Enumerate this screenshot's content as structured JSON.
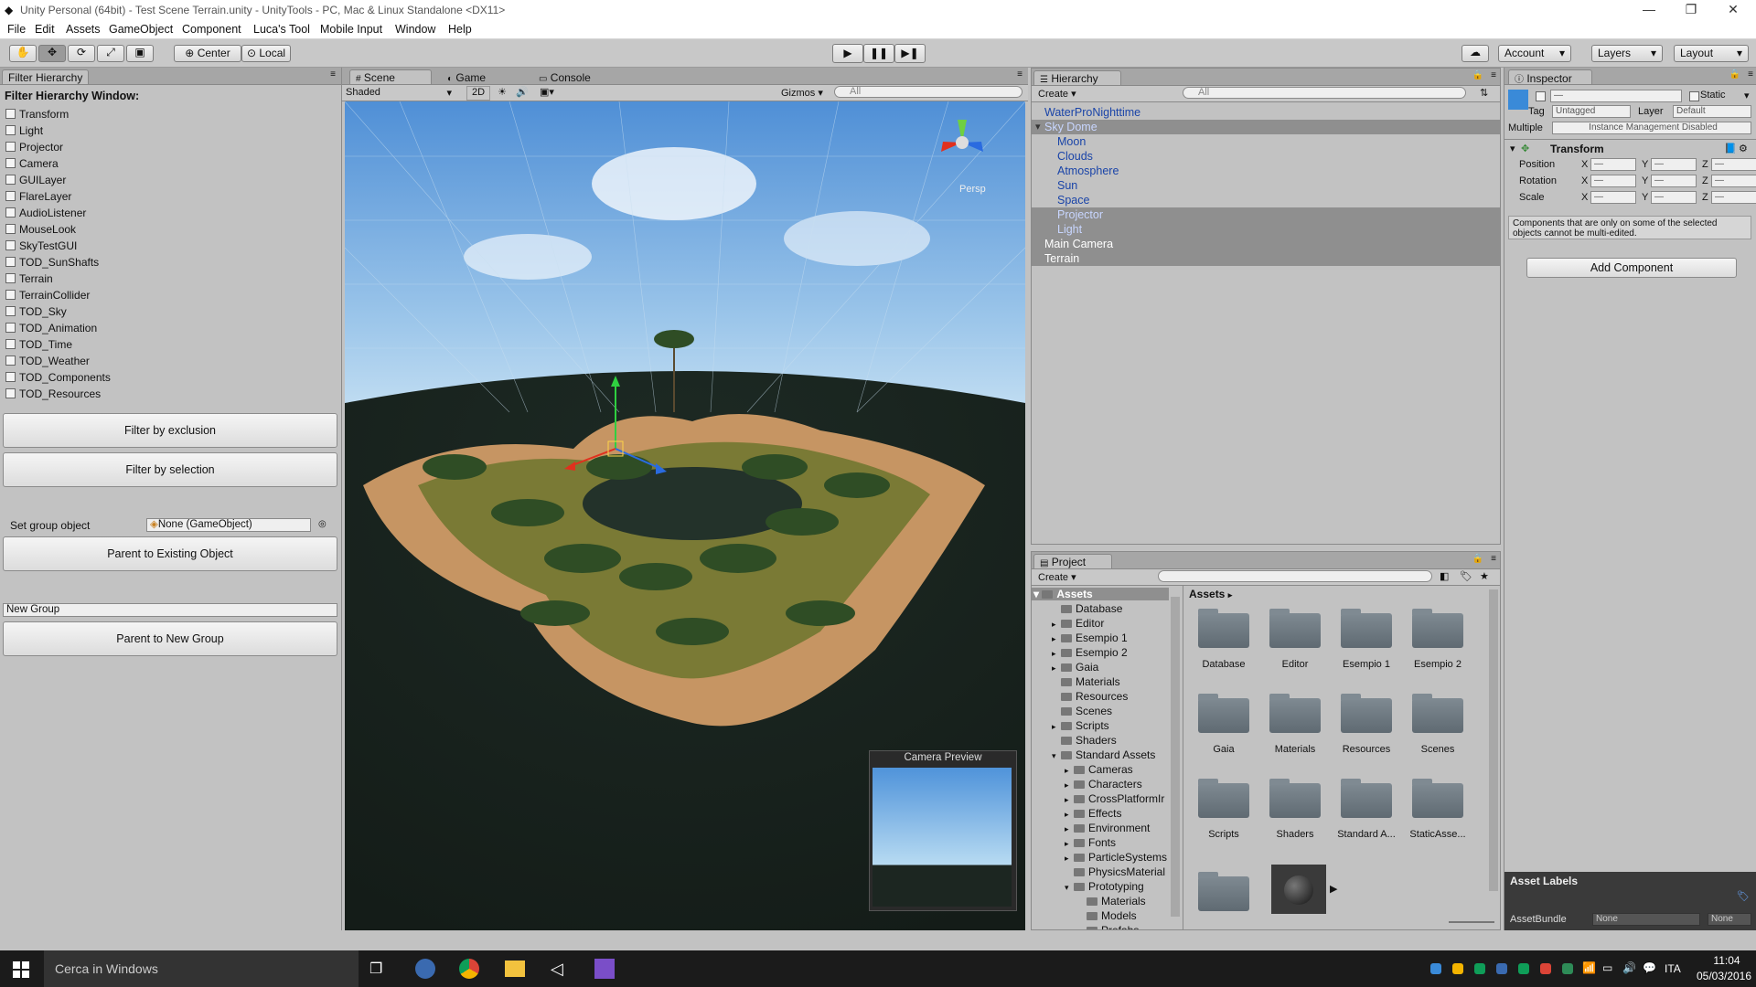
{
  "window": {
    "title": "Unity Personal (64bit) - Test Scene Terrain.unity - UnityTools - PC, Mac & Linux Standalone <DX11>",
    "controls": [
      "—",
      "❐",
      "✕"
    ]
  },
  "menu": [
    "File",
    "Edit",
    "Assets",
    "GameObject",
    "Component",
    "Luca's Tool",
    "Mobile Input",
    "Window",
    "Help"
  ],
  "toolbar": {
    "pivot": "Center",
    "space": "Local",
    "account": "Account",
    "layers": "Layers",
    "layout": "Layout"
  },
  "filter_panel": {
    "tab": "Filter Hierarchy",
    "heading": "Filter Hierarchy Window:",
    "items": [
      "Transform",
      "Light",
      "Projector",
      "Camera",
      "GUILayer",
      "FlareLayer",
      "AudioListener",
      "MouseLook",
      "SkyTestGUI",
      "TOD_SunShafts",
      "Terrain",
      "TerrainCollider",
      "TOD_Sky",
      "TOD_Animation",
      "TOD_Time",
      "TOD_Weather",
      "TOD_Components",
      "TOD_Resources"
    ],
    "btn_exclusion": "Filter by exclusion",
    "btn_selection": "Filter by selection",
    "group_label": "Set group object",
    "group_value": "None (GameObject)",
    "btn_parent_existing": "Parent to Existing Object",
    "new_group_value": "New Group",
    "btn_parent_new": "Parent to New Group"
  },
  "scene": {
    "tabs": [
      "Scene",
      "Game",
      "Console"
    ],
    "shading": "Shaded",
    "mode2d": "2D",
    "gizmos": "Gizmos",
    "search_placeholder": "All",
    "persp": "Persp",
    "camera_preview": "Camera Preview"
  },
  "hierarchy": {
    "tab": "Hierarchy",
    "create": "Create",
    "search_placeholder": "All",
    "items": [
      {
        "name": "WaterProNighttime",
        "indent": 0
      },
      {
        "name": "Sky Dome",
        "indent": 0
      },
      {
        "name": "Moon",
        "indent": 1
      },
      {
        "name": "Clouds",
        "indent": 1
      },
      {
        "name": "Atmosphere",
        "indent": 1
      },
      {
        "name": "Sun",
        "indent": 1
      },
      {
        "name": "Space",
        "indent": 1
      },
      {
        "name": "Projector",
        "indent": 1
      },
      {
        "name": "Light",
        "indent": 1
      },
      {
        "name": "Main Camera",
        "indent": 0
      },
      {
        "name": "Terrain",
        "indent": 0
      }
    ]
  },
  "inspector": {
    "tab": "Inspector",
    "name_value": "—",
    "static_label": "Static",
    "tag_label": "Tag",
    "tag_value": "Untagged",
    "layer_label": "Layer",
    "layer_value": "Default",
    "multiple": "Multiple",
    "instance": "Instance Management Disabled",
    "transform": "Transform",
    "rows": [
      "Position",
      "Rotation",
      "Scale"
    ],
    "axes": [
      "X",
      "Y",
      "Z"
    ],
    "dash": "—",
    "note": "Components that are only on some of the selected objects cannot be multi-edited.",
    "add_component": "Add Component",
    "asset_labels": "Asset Labels",
    "asset_bundle": "AssetBundle",
    "bundle_value": "None",
    "bundle_variant": "None"
  },
  "project": {
    "tab": "Project",
    "create": "Create",
    "root": "Assets",
    "tree": [
      {
        "name": "Database",
        "indent": 1
      },
      {
        "name": "Editor",
        "indent": 1
      },
      {
        "name": "Esempio 1",
        "indent": 1
      },
      {
        "name": "Esempio 2",
        "indent": 1
      },
      {
        "name": "Gaia",
        "indent": 1
      },
      {
        "name": "Materials",
        "indent": 1
      },
      {
        "name": "Resources",
        "indent": 1
      },
      {
        "name": "Scenes",
        "indent": 1
      },
      {
        "name": "Scripts",
        "indent": 1
      },
      {
        "name": "Shaders",
        "indent": 1
      },
      {
        "name": "Standard Assets",
        "indent": 1
      },
      {
        "name": "Cameras",
        "indent": 2
      },
      {
        "name": "Characters",
        "indent": 2
      },
      {
        "name": "CrossPlatformIr",
        "indent": 2
      },
      {
        "name": "Effects",
        "indent": 2
      },
      {
        "name": "Environment",
        "indent": 2
      },
      {
        "name": "Fonts",
        "indent": 2
      },
      {
        "name": "ParticleSystems",
        "indent": 2
      },
      {
        "name": "PhysicsMaterial",
        "indent": 2
      },
      {
        "name": "Prototyping",
        "indent": 2
      },
      {
        "name": "Materials",
        "indent": 3
      },
      {
        "name": "Models",
        "indent": 3
      },
      {
        "name": "Prefabs",
        "indent": 3
      }
    ],
    "breadcrumb": "Assets",
    "grid": [
      "Database",
      "Editor",
      "Esempio 1",
      "Esempio 2",
      "Gaia",
      "Materials",
      "Resources",
      "Scenes",
      "Scripts",
      "Shaders",
      "Standard A...",
      "StaticAsse..."
    ]
  },
  "taskbar": {
    "search": "Cerca in Windows",
    "lang": "ITA",
    "time": "11:04",
    "date": "05/03/2016"
  },
  "colors": {
    "selected_text": "#e8e8ff",
    "prefab_blue": "#1a44a8"
  }
}
